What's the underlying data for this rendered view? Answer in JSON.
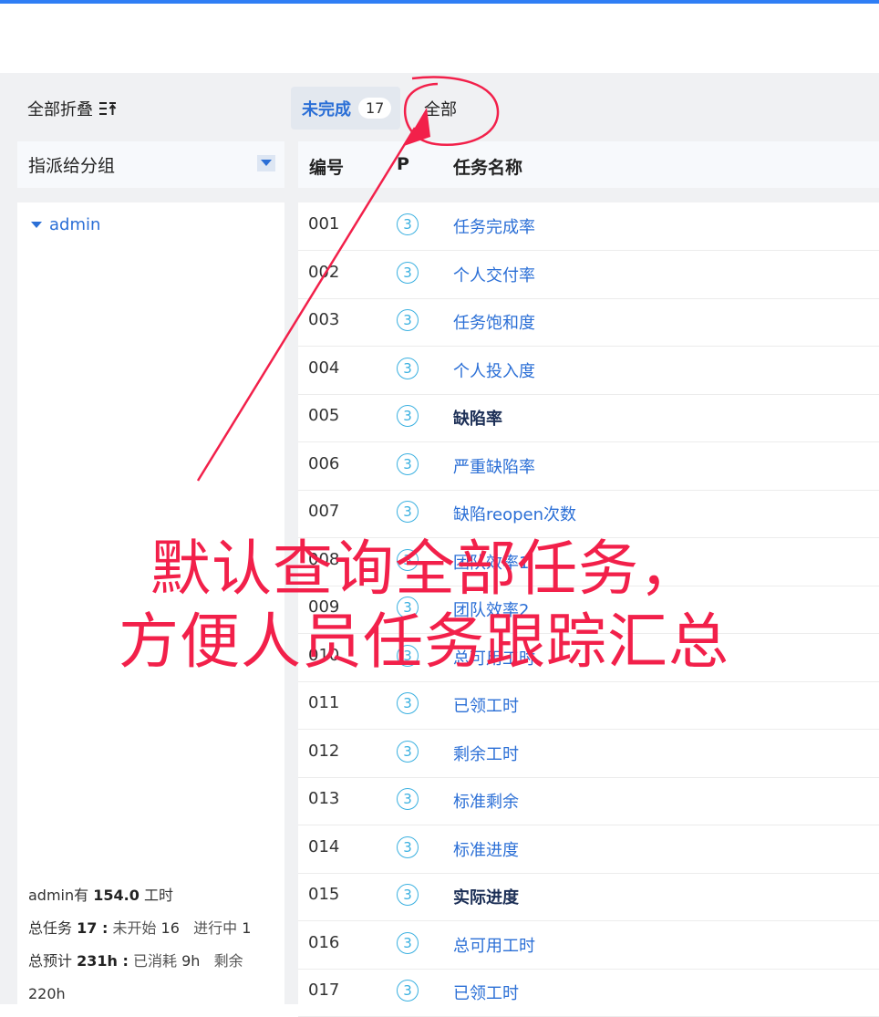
{
  "toolbar": {
    "collapse_all_label": "全部折叠",
    "tabs": [
      {
        "label": "未完成",
        "count": "17"
      },
      {
        "label": "全部"
      }
    ]
  },
  "left_panel": {
    "group_select": {
      "value": "指派给分组"
    },
    "tree": [
      {
        "label": "admin",
        "expanded": true
      }
    ],
    "summary": {
      "line1_prefix": "admin有",
      "line1_hours": "154.0",
      "line1_suffix": "工时",
      "line2_prefix": "总任务",
      "line2_total": "17 :",
      "line2_notstarted_label": "未开始",
      "line2_notstarted": "16",
      "line2_inprogress_label": "进行中",
      "line2_inprogress": "1",
      "line3_prefix": "总预计",
      "line3_total": "231h :",
      "line3_consumed_label": "已消耗",
      "line3_consumed": "9h",
      "line3_remaining_label": "剩余",
      "line4_remaining": "220h"
    }
  },
  "table": {
    "columns": [
      "编号",
      "P",
      "任务名称"
    ],
    "rows": [
      {
        "id": "001",
        "p": "3",
        "name": "任务完成率"
      },
      {
        "id": "002",
        "p": "3",
        "name": "个人交付率"
      },
      {
        "id": "003",
        "p": "3",
        "name": "任务饱和度"
      },
      {
        "id": "004",
        "p": "3",
        "name": "个人投入度"
      },
      {
        "id": "005",
        "p": "3",
        "name": "缺陷率"
      },
      {
        "id": "006",
        "p": "3",
        "name": "严重缺陷率"
      },
      {
        "id": "007",
        "p": "3",
        "name": "缺陷reopen次数"
      },
      {
        "id": "008",
        "p": "3",
        "name": "团队效率1"
      },
      {
        "id": "009",
        "p": "3",
        "name": "团队效率2"
      },
      {
        "id": "010",
        "p": "3",
        "name": "总可用工时"
      },
      {
        "id": "011",
        "p": "3",
        "name": "已领工时"
      },
      {
        "id": "012",
        "p": "3",
        "name": "剩余工时"
      },
      {
        "id": "013",
        "p": "3",
        "name": "标准剩余"
      },
      {
        "id": "014",
        "p": "3",
        "name": "标准进度"
      },
      {
        "id": "015",
        "p": "3",
        "name": "实际进度"
      },
      {
        "id": "016",
        "p": "3",
        "name": "总可用工时"
      },
      {
        "id": "017",
        "p": "3",
        "name": "已领工时"
      }
    ]
  },
  "annotation": {
    "line1": "默认查询全部任务，",
    "line2": "方便人员任务跟踪汇总",
    "color": "#f2204a"
  },
  "colors": {
    "accent": "#2b6fd6",
    "top_bar": "#2f7ef5",
    "priority": "#3ab0e0"
  }
}
